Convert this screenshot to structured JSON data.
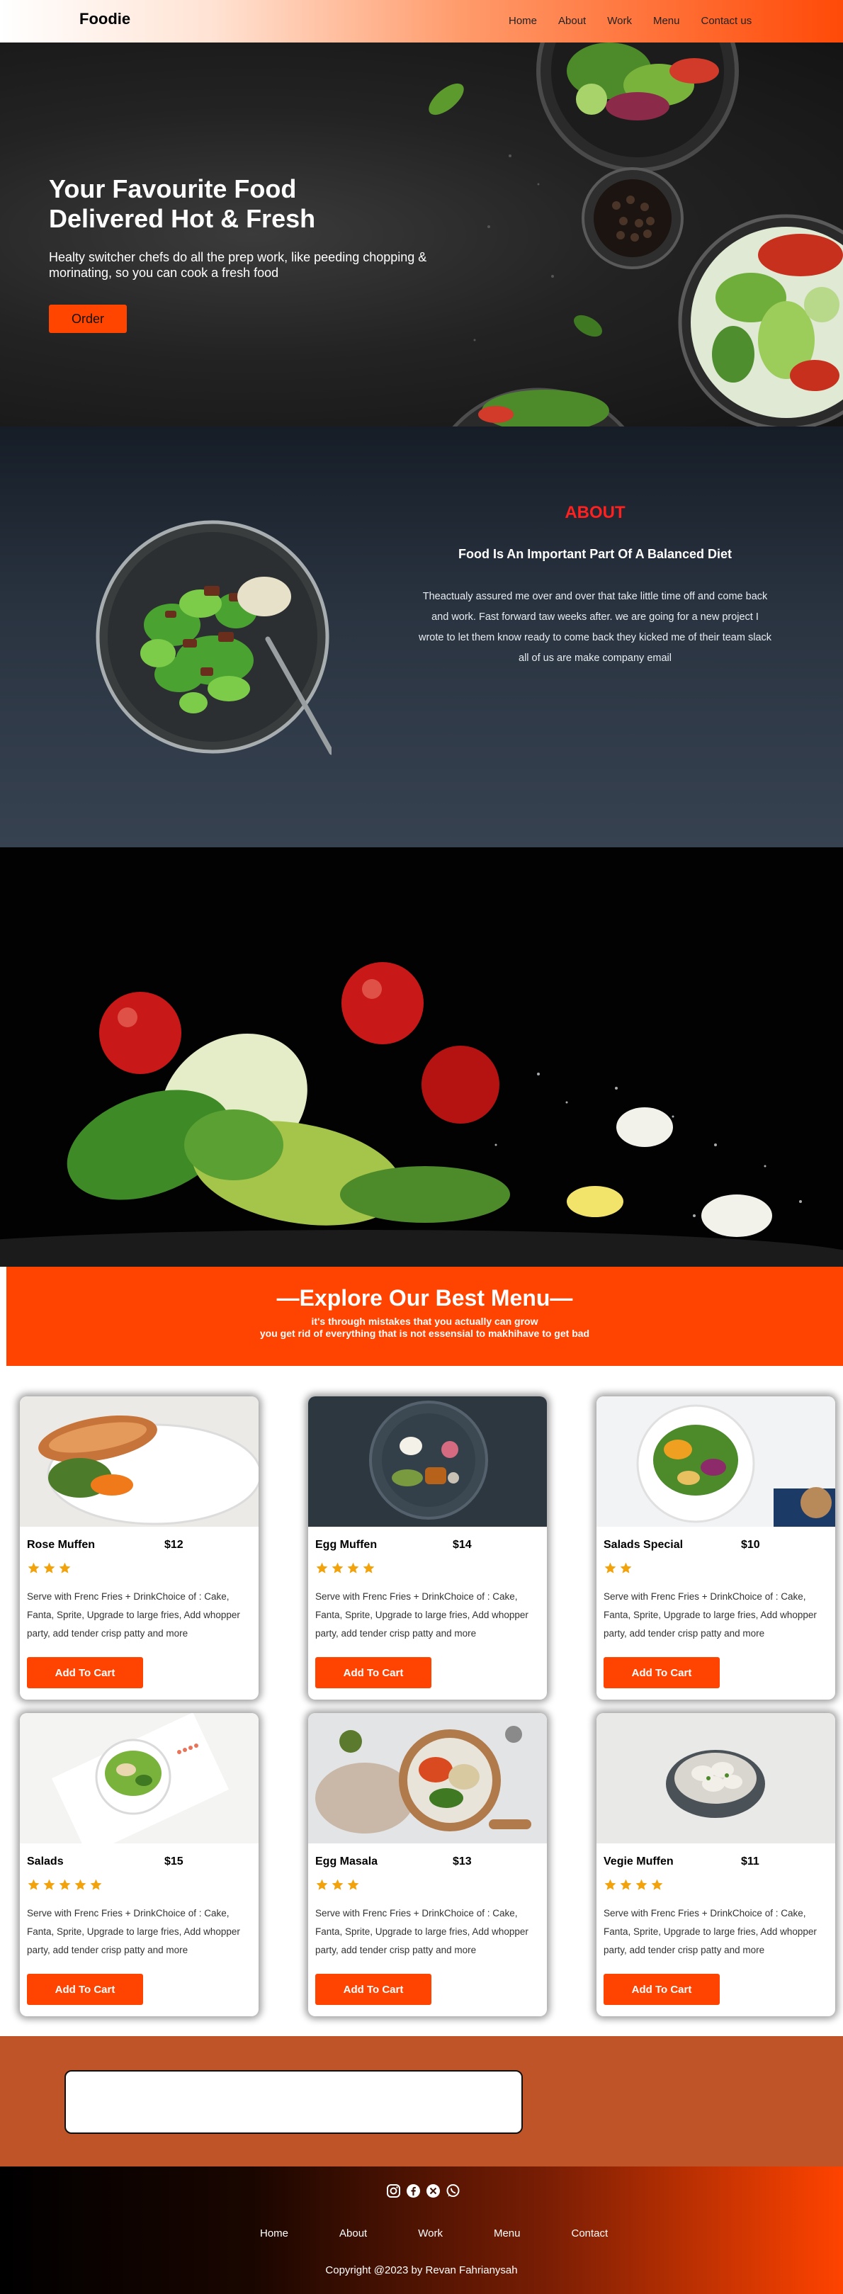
{
  "navbar": {
    "brand": "Foodie",
    "links": [
      "Home",
      "About",
      "Work",
      "Menu",
      "Contact us"
    ]
  },
  "hero": {
    "title_line1": "Your Favourite Food",
    "title_line2": "Delivered Hot & Fresh",
    "subtitle": "Healty switcher chefs do all the prep work, like peeding chopping & morinating, so you can cook a fresh food",
    "cta": "Order"
  },
  "about": {
    "title": "ABOUT",
    "subtitle": "Food Is An Important Part Of A Balanced Diet",
    "body": "Theactualy assured me over and over that take little time off and come back and work. Fast forward taw weeks after. we are going for a new project I wrote to let them know ready to come back they kicked me of their team slack all of us are make company email"
  },
  "menu": {
    "title": "—Explore Our Best Menu—",
    "tagline_line1": "it's through mistakes that you actually can grow",
    "tagline_line2": "you get rid of everything that is not essensial to makhihave to get bad",
    "items": [
      {
        "name": "Rose Muffen",
        "price": "$12",
        "rating": 3,
        "description": "Serve with Frenc Fries + DrinkChoice of : Cake, Fanta, Sprite, Upgrade to large fries, Add whopper party, add tender crisp patty and more",
        "button": "Add To Cart"
      },
      {
        "name": "Egg Muffen",
        "price": "$14",
        "rating": 4,
        "description": "Serve with Frenc Fries + DrinkChoice of : Cake, Fanta, Sprite, Upgrade to large fries, Add whopper party, add tender crisp patty and more",
        "button": "Add To Cart"
      },
      {
        "name": "Salads Special",
        "price": "$10",
        "rating": 2,
        "description": "Serve with Frenc Fries + DrinkChoice of : Cake, Fanta, Sprite, Upgrade to large fries, Add whopper party, add tender crisp patty and more",
        "button": "Add To Cart"
      },
      {
        "name": "Salads",
        "price": "$15",
        "rating": 5,
        "description": "Serve with Frenc Fries + DrinkChoice of : Cake, Fanta, Sprite, Upgrade to large fries, Add whopper party, add tender crisp patty and more",
        "button": "Add To Cart"
      },
      {
        "name": "Egg Masala",
        "price": "$13",
        "rating": 3,
        "description": "Serve with Frenc Fries + DrinkChoice of : Cake, Fanta, Sprite, Upgrade to large fries, Add whopper party, add tender crisp patty and more",
        "button": "Add To Cart"
      },
      {
        "name": "Vegie Muffen",
        "price": "$11",
        "rating": 4,
        "description": "Serve with Frenc Fries + DrinkChoice of : Cake, Fanta, Sprite, Upgrade to large fries, Add whopper party, add tender crisp patty and more",
        "button": "Add To Cart"
      }
    ]
  },
  "footer": {
    "socials": [
      "instagram-icon",
      "facebook-icon",
      "x-icon",
      "whatsapp-icon"
    ],
    "links": [
      "Home",
      "About",
      "Work",
      "Menu",
      "Contact"
    ],
    "copyright": "Copyright @2023 by Revan Fahrianysah"
  },
  "colors": {
    "accent": "#ff4300",
    "about_title": "#ff2020",
    "newsletter_bg": "#c05429"
  }
}
